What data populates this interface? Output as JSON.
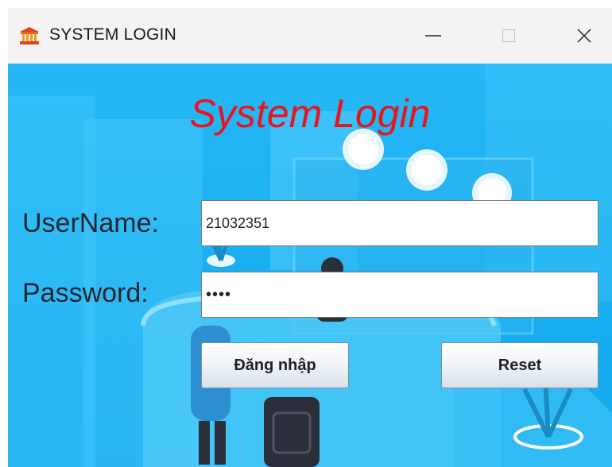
{
  "window": {
    "title": "SYSTEM LOGIN",
    "app_icon": "bank-building-icon",
    "controls": [
      "minimize-icon",
      "maximize-icon",
      "close-icon"
    ]
  },
  "login": {
    "heading": "System Login",
    "username_label": "UserName:",
    "username_value": "21032351",
    "password_label": "Password:",
    "password_value": "••••",
    "login_button": "Đăng nhập",
    "reset_button": "Reset"
  },
  "colors": {
    "heading": "#e8141c",
    "background": "#1ab0f2",
    "titlebar": "#f3f3f3"
  }
}
